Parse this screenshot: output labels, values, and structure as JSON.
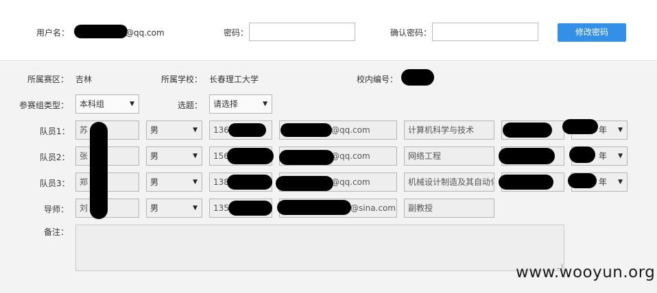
{
  "header": {
    "username_label": "用户名：",
    "username_suffix": "@qq.com",
    "password_label": "密码：",
    "confirm_label": "确认密码：",
    "change_button": "修改密码"
  },
  "info": {
    "region_label": "所属赛区：",
    "region_value": "吉林",
    "school_label": "所属学校：",
    "school_value": "长春理工大学",
    "campus_id_label": "校内编号："
  },
  "options": {
    "group_label": "参赛组类型：",
    "group_value": "本科组",
    "topic_label": "选题：",
    "topic_value": "请选择"
  },
  "members": [
    {
      "role": "队员1：",
      "name": "苏",
      "gender": "男",
      "phone": "1369",
      "email": "@qq.com",
      "major": "计算机科学与技术",
      "grade": "年"
    },
    {
      "role": "队员2：",
      "name": "张",
      "gender": "男",
      "phone": "156",
      "email": "@qq.com",
      "major": "网络工程",
      "grade": "年"
    },
    {
      "role": "队员3：",
      "name": "郑",
      "gender": "男",
      "phone": "138",
      "email": "@qq.com",
      "major": "机械设计制造及其自动化",
      "grade": "年"
    }
  ],
  "advisor": {
    "role": "导师：",
    "name": "刘",
    "gender": "男",
    "phone": "1357",
    "email": "@sina.com",
    "title": "副教授"
  },
  "remark": {
    "label": "备注："
  },
  "watermark": "www.wooyun.org"
}
